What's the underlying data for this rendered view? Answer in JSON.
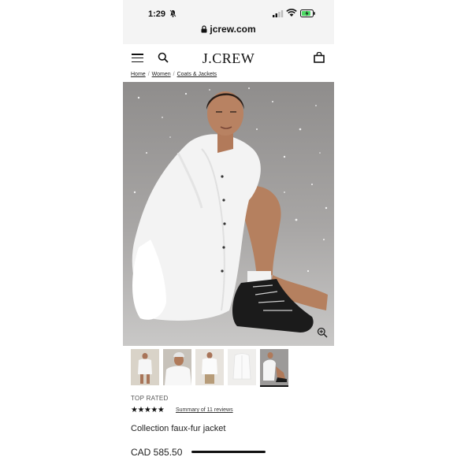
{
  "status_bar": {
    "time": "1:29"
  },
  "browser": {
    "url": "jcrew.com"
  },
  "header": {
    "logo": "J.CREW"
  },
  "breadcrumb": [
    {
      "label": "Home"
    },
    {
      "label": "Women"
    },
    {
      "label": "Coats & Jackets"
    }
  ],
  "product": {
    "badge": "TOP RATED",
    "rating": 4.5,
    "rating_stars": "★★★★★",
    "reviews_link": "Summary of 11 reviews",
    "name": "Collection faux-fur jacket",
    "price": "CAD 585.50"
  },
  "thumbnails": [
    {
      "name": "thumbnail-1",
      "selected": false
    },
    {
      "name": "thumbnail-2",
      "selected": false
    },
    {
      "name": "thumbnail-3",
      "selected": false
    },
    {
      "name": "thumbnail-4",
      "selected": false
    },
    {
      "name": "thumbnail-5",
      "selected": true
    }
  ],
  "colors": {
    "brand_text": "#111111",
    "hero_bg": "#9a9897"
  }
}
